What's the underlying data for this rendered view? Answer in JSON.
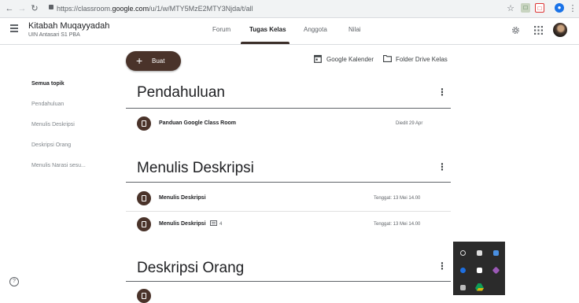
{
  "browser": {
    "url_prefix": "https://classroom.",
    "url_host": "google.com",
    "url_path": "/u/1/w/MTY5MzE2MTY3Njda/t/all",
    "back_icon": "arrow-left-icon",
    "forward_icon": "arrow-right-icon",
    "reload_icon": "reload-icon",
    "bookmark_icon": "star-icon",
    "menu_icon": "kebab-icon"
  },
  "header": {
    "class_name": "Kitabah Muqayyadah",
    "class_subtitle": "UIN Antasari S1 PBA",
    "tabs": [
      "Forum",
      "Tugas Kelas",
      "Anggota",
      "Nilai"
    ],
    "active_tab": "Tugas Kelas"
  },
  "toolbar": {
    "create_label": "Buat",
    "calendar_label": "Google Kalender",
    "drive_label": "Folder Drive Kelas"
  },
  "sidebar": {
    "items": [
      "Semua topik",
      "Pendahuluan",
      "Menulis Deskripsi",
      "Deskripsi Orang",
      "Menulis Narasi sesu..."
    ]
  },
  "topics": [
    {
      "title": "Pendahuluan",
      "items": [
        {
          "name": "Panduan Google Class Room",
          "meta": "Diedit 29 Apr"
        }
      ]
    },
    {
      "title": "Menulis Deskripsi",
      "items": [
        {
          "name": "Menulis Deskripsi",
          "meta": "Tenggat: 13 Mei 14.00"
        },
        {
          "name": "Menulis Deskripsi",
          "comment_count": "4",
          "meta": "Tenggat: 13 Mei 14.00"
        }
      ]
    },
    {
      "title": "Deskripsi Orang",
      "items": []
    }
  ],
  "colors": {
    "brand": "#4a332a",
    "tray_bg": "#2b2b2b"
  }
}
